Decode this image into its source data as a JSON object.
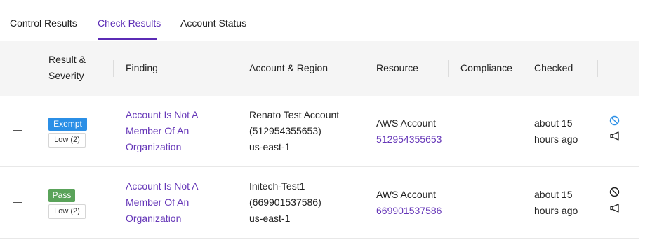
{
  "tabs": [
    {
      "label": "Control Results",
      "active": false
    },
    {
      "label": "Check Results",
      "active": true
    },
    {
      "label": "Account Status",
      "active": false
    }
  ],
  "table": {
    "headers": {
      "result_line1": "Result &",
      "result_line2": "Severity",
      "finding": "Finding",
      "account_region": "Account & Region",
      "resource": "Resource",
      "compliance": "Compliance",
      "checked": "Checked"
    },
    "rows": [
      {
        "result": "Exempt",
        "severity": "Low (2)",
        "finding": [
          "Account Is Not A",
          "Member Of An",
          "Organization"
        ],
        "account_name": "Renato Test Account",
        "account_id": "(512954355653)",
        "region": "us-east-1",
        "resource_type": "AWS Account",
        "resource_id": "512954355653",
        "checked": [
          "about 15",
          "hours ago"
        ]
      },
      {
        "result": "Pass",
        "severity": "Low (2)",
        "finding": [
          "Account Is Not A",
          "Member Of An",
          "Organization"
        ],
        "account_name": "Initech-Test1",
        "account_id": "(669901537586)",
        "region": "us-east-1",
        "resource_type": "AWS Account",
        "resource_id": "669901537586",
        "checked": [
          "about 15",
          "hours ago"
        ]
      }
    ]
  },
  "colors": {
    "accent": "#5b2bb5",
    "link": "#6637b8",
    "exempt": "#2b8fe6",
    "pass": "#5aa35a",
    "exempt_icon": "#2b8fe6"
  },
  "icons": {
    "expand": "plus-icon",
    "exempt_action": "ban-icon",
    "notify_action": "megaphone-icon"
  }
}
